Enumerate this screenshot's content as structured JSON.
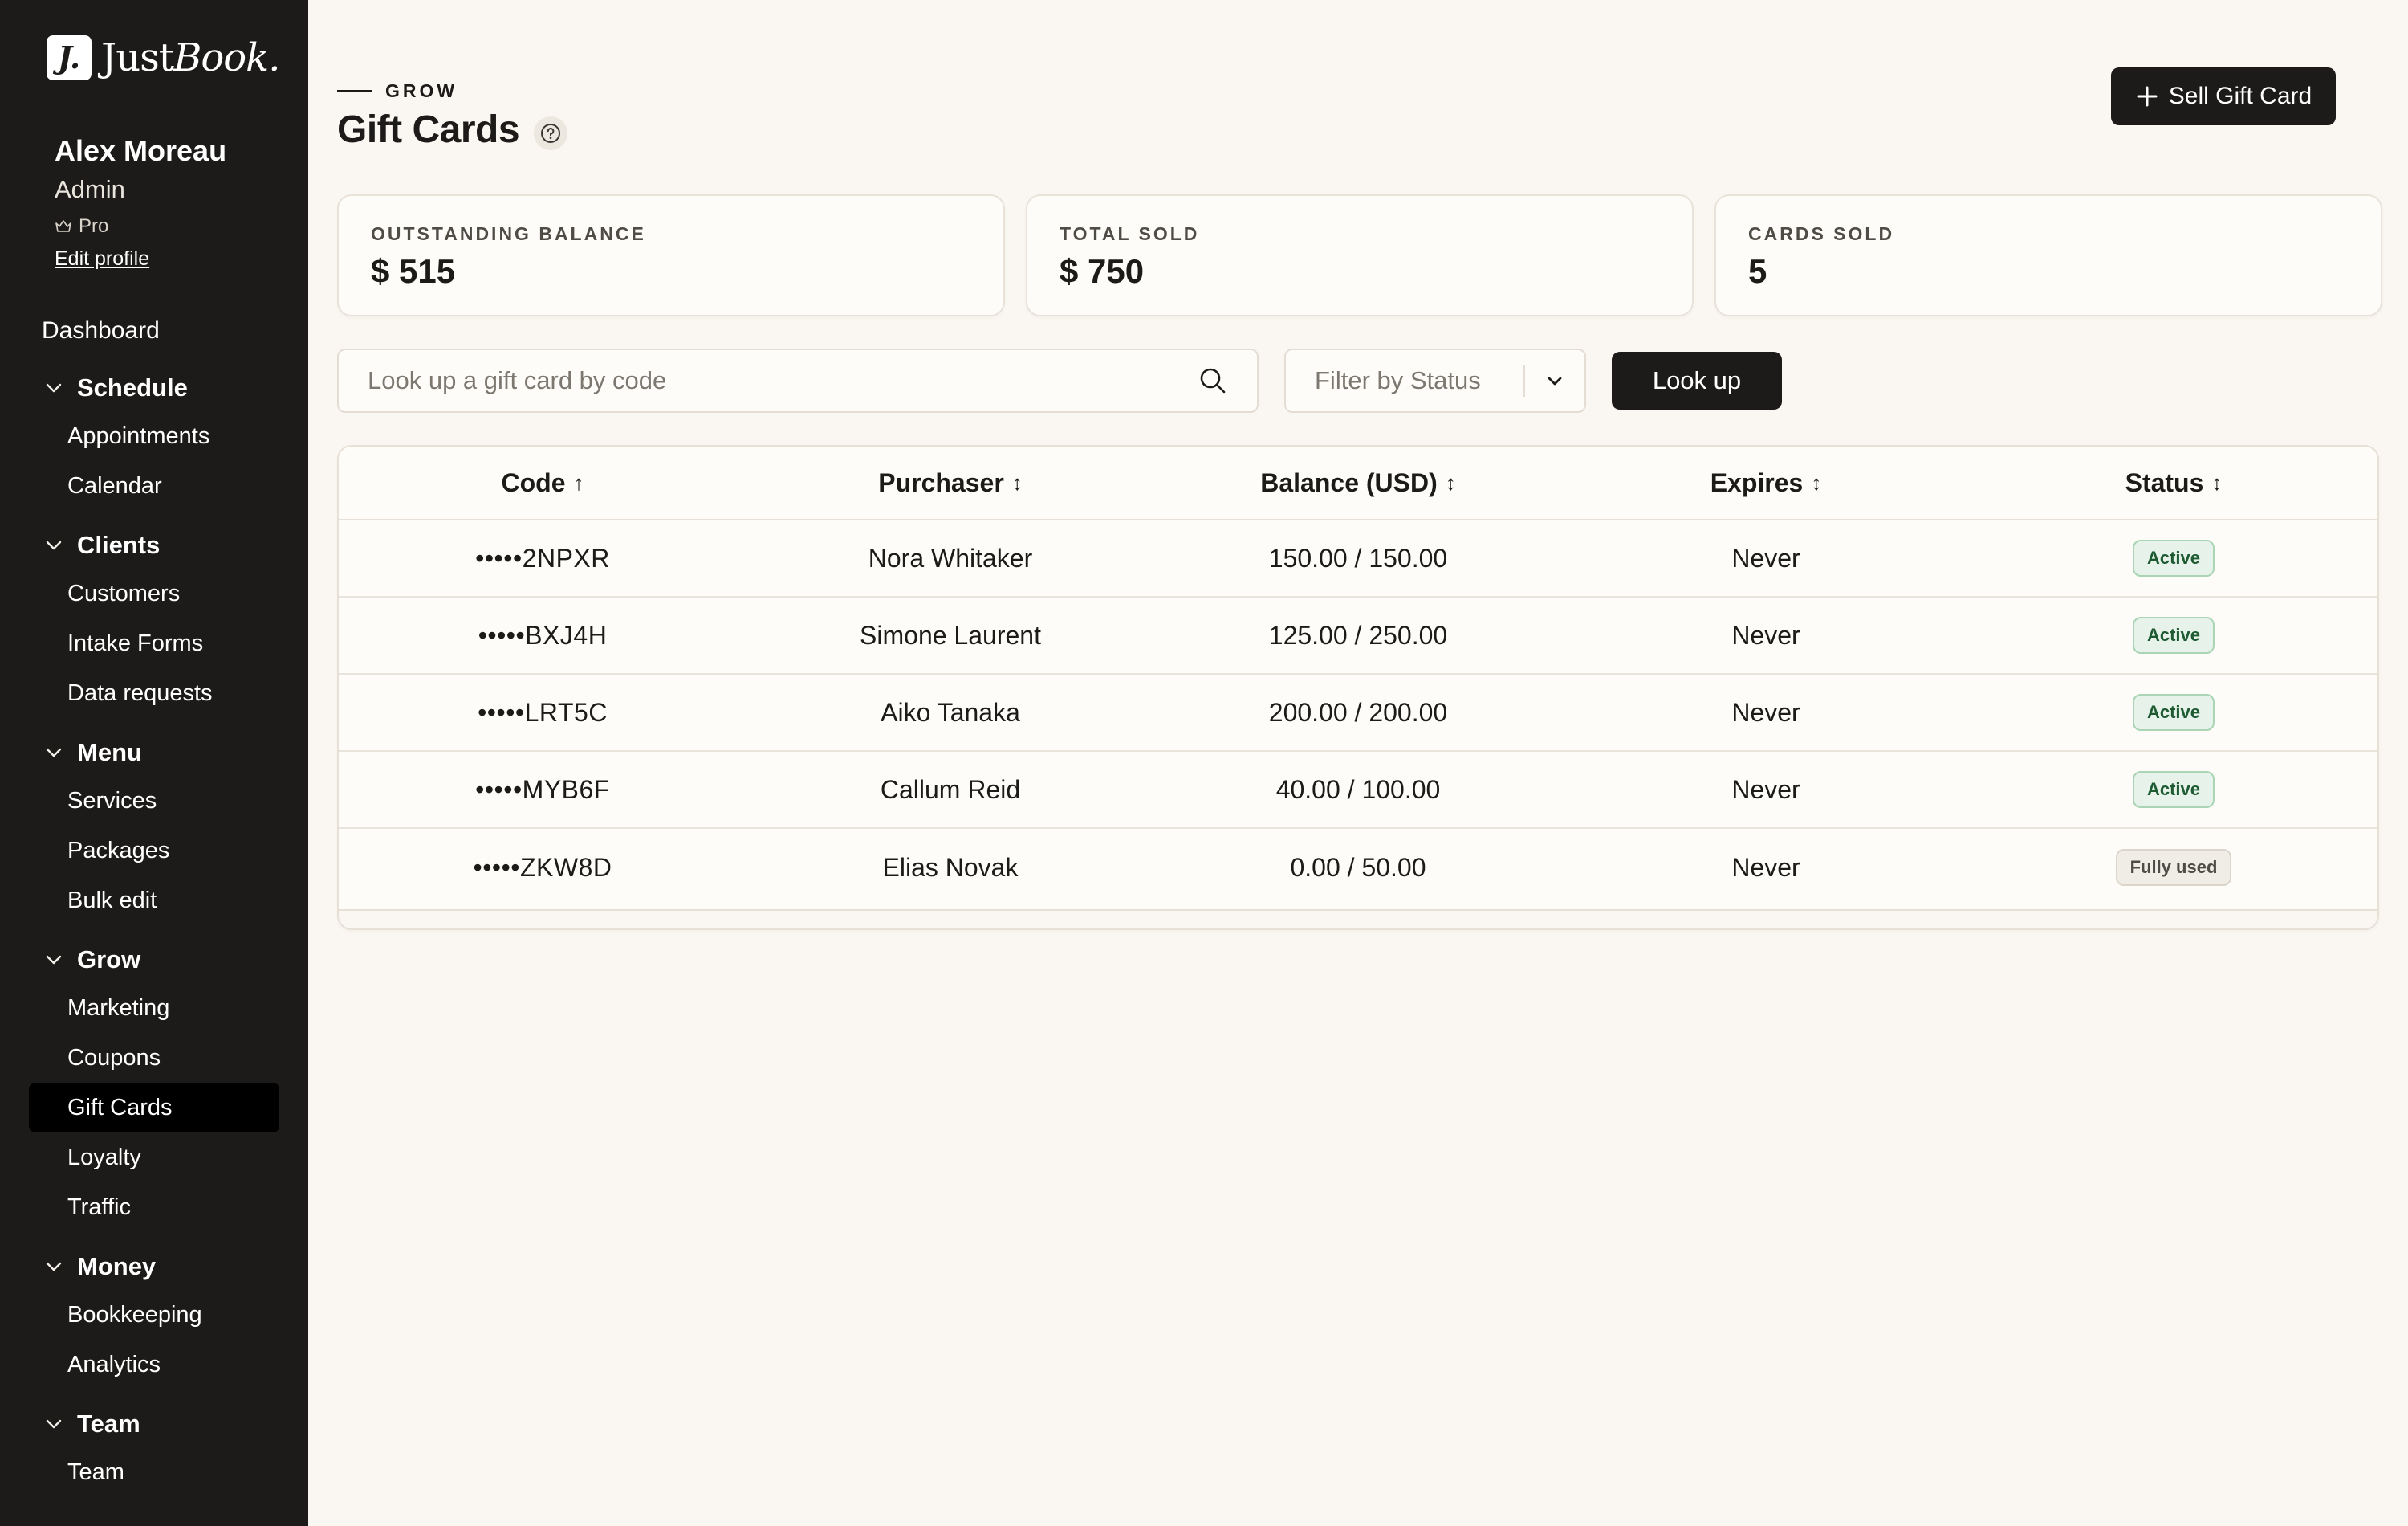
{
  "brand": {
    "mark": "J.",
    "name_regular": "Just",
    "name_italic": "Book."
  },
  "user": {
    "name": "Alex Moreau",
    "role": "Admin",
    "plan": "Pro",
    "edit_label": "Edit profile"
  },
  "nav": {
    "dashboard": "Dashboard",
    "groups": [
      {
        "label": "Schedule",
        "items": [
          "Appointments",
          "Calendar"
        ]
      },
      {
        "label": "Clients",
        "items": [
          "Customers",
          "Intake Forms",
          "Data requests"
        ]
      },
      {
        "label": "Menu",
        "items": [
          "Services",
          "Packages",
          "Bulk edit"
        ]
      },
      {
        "label": "Grow",
        "items": [
          "Marketing",
          "Coupons",
          "Gift Cards",
          "Loyalty",
          "Traffic"
        ]
      },
      {
        "label": "Money",
        "items": [
          "Bookkeeping",
          "Analytics"
        ]
      },
      {
        "label": "Team",
        "items": [
          "Team"
        ]
      }
    ],
    "active_item": "Gift Cards"
  },
  "header": {
    "eyebrow": "GROW",
    "title": "Gift Cards",
    "sell_button": "Sell Gift Card"
  },
  "stats": [
    {
      "label": "OUTSTANDING BALANCE",
      "value": "$ 515"
    },
    {
      "label": "TOTAL SOLD",
      "value": "$ 750"
    },
    {
      "label": "CARDS SOLD",
      "value": "5"
    }
  ],
  "toolbar": {
    "search_placeholder": "Look up a gift card by code",
    "filter_label": "Filter by Status",
    "lookup_button": "Look up"
  },
  "table": {
    "columns": [
      {
        "label": "Code",
        "sort": "↑"
      },
      {
        "label": "Purchaser",
        "sort": "↕"
      },
      {
        "label": "Balance (USD)",
        "sort": "↕"
      },
      {
        "label": "Expires",
        "sort": "↕"
      },
      {
        "label": "Status",
        "sort": "↕"
      }
    ],
    "rows": [
      {
        "code": "•••••2NPXR",
        "purchaser": "Nora Whitaker",
        "balance": "150.00 / 150.00",
        "expires": "Never",
        "status": "Active"
      },
      {
        "code": "•••••BXJ4H",
        "purchaser": "Simone Laurent",
        "balance": "125.00 / 250.00",
        "expires": "Never",
        "status": "Active"
      },
      {
        "code": "•••••LRT5C",
        "purchaser": "Aiko Tanaka",
        "balance": "200.00 / 200.00",
        "expires": "Never",
        "status": "Active"
      },
      {
        "code": "•••••MYB6F",
        "purchaser": "Callum Reid",
        "balance": "40.00 / 100.00",
        "expires": "Never",
        "status": "Active"
      },
      {
        "code": "•••••ZKW8D",
        "purchaser": "Elias Novak",
        "balance": "0.00 / 50.00",
        "expires": "Never",
        "status": "Fully used"
      }
    ]
  },
  "colors": {
    "sidebar_bg": "#1c1b19",
    "page_bg": "#faf6f1",
    "active_badge": "#e7f3ea",
    "used_badge": "#f0ede7"
  }
}
